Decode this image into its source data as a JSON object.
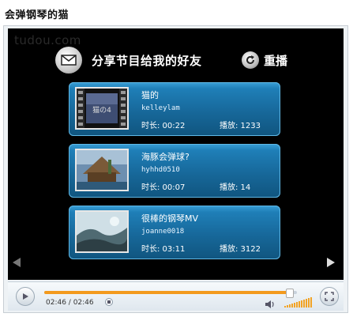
{
  "page": {
    "title": "会弹钢琴的猫"
  },
  "player": {
    "watermark": "tudou.com",
    "share_label": "分享节目给我的好友",
    "replay_label": "重播",
    "colors": {
      "accent": "#f39a1e",
      "card": "#1f7fb8"
    }
  },
  "videos": [
    {
      "title": "猫的",
      "user": "kelleylam",
      "duration": "时长: 00:22",
      "plays": "播放: 1233",
      "thumb_caption": "猫の4"
    },
    {
      "title": "海豚会弹球?",
      "user": "hyhhd0510",
      "duration": "时长: 00:07",
      "plays": "播放: 14"
    },
    {
      "title": "很棒的钢琴MV",
      "user": "joanne0018",
      "duration": "时长: 03:11",
      "plays": "播放: 3122"
    }
  ],
  "controls": {
    "time": "02:46 / 02:46",
    "progress_fraction": 0.97,
    "icons": [
      "play-icon",
      "stop-icon",
      "volume-icon",
      "fullscreen-icon",
      "left-arrow-icon",
      "right-arrow-icon"
    ]
  }
}
